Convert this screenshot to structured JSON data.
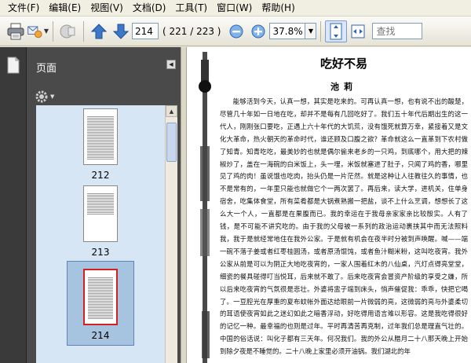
{
  "menu": {
    "items": [
      "文件(F)",
      "编辑(E)",
      "视图(V)",
      "文档(D)",
      "工具(T)",
      "窗口(W)",
      "帮助(H)"
    ]
  },
  "toolbar": {
    "current_page": "214",
    "page_count": "( 221 / 223 )",
    "zoom": "37.8%",
    "search_placeholder": "查找"
  },
  "panel": {
    "title": "页面",
    "thumbnails": [
      {
        "label": "212",
        "selected": false
      },
      {
        "label": "213",
        "selected": false
      },
      {
        "label": "214",
        "selected": true
      }
    ]
  },
  "document": {
    "title": "吃好不易",
    "author": "池莉",
    "body": "能够活到今天，认真一想，其实是吃来的。可再认真一想，也有说不出的酸楚，尽管几十年如一日地在吃，却并不是每有几回吃好了。我们五十年代后期出生的这一代人，刚刚张口要吃，正遇上六十年代的大饥荒，没有饿死就算万幸，紧接着又是文化大革命，热火朝天的革命时代，谁还顾及口腹之欲？革命就这么一直革到下农村做了知青。知青吃吃，最美妙的也就是偶尔偷来老乡的一只鸡，到底哪个，用大把的辣椒炒了，盖在一海碗的白米饭上，头一埋，米饭就塞进了肚子，只闻了鸡的香，哪里见了鸡的肉！虽说饿也吃肉，抬头仍是一片茫然。就是这种让人往教往久的事情，也不是常有的，一年里只能也就做它个一两次罢了。再后来，读大学，进机关，住单身宿舍，吃集体食堂，所有菜肴都是大锅煮熟搬一把盐，谈不上什么烹调，想想长了这么大一个人，一直都是在果腹而已。我的幸运在于我母亲家家亲比较殷实。人有了钱，是不可能不讲究吃的。由于我的父母被一系列的政治运动裹挟其中而无法照料我，我于是就经常地住在我外公家。于是就有机会在夜半时分被到声唤醒。喊——端一碗不落子姜或者红枣桂圆汤，或者原汤馄饨，或者鱼汁糊米粉，这叫吃夜宵。我外公家从前是可以为阴正大地吃夜宵的，一家人围着红木的八仙桌，汽灯点得亮堂堂，细瓷的餐具碰得叮当悦耳，后来就不敢了。后来吃夜宵会冒资产阶级的享受之嫌，所以后来吃夜宵的气氛很是悲壮。外婆将盅子端到床头，悄声催促我：乖乖，快把它喝了。一豆腔光在厚重的夏布蚊帐外面达给眼前一片微弱的亮，这微弱的亮与外婆柔切的耳语使夜宵如此之迷幻如此之暗香浮动，好吃得用语言难以形容。这是我吃得很好的记忆一种。最幸福的也则是过年。平时再清苦再克制，过年我们总是理直气壮的。中国的俗话说：叫化子都有三天年。何况我们。我的外公从腊月二十八那天晚上开始到除夕夜是不睡觉的。二十八晚上家里必须开油锅。我们湖北的年"
  }
}
